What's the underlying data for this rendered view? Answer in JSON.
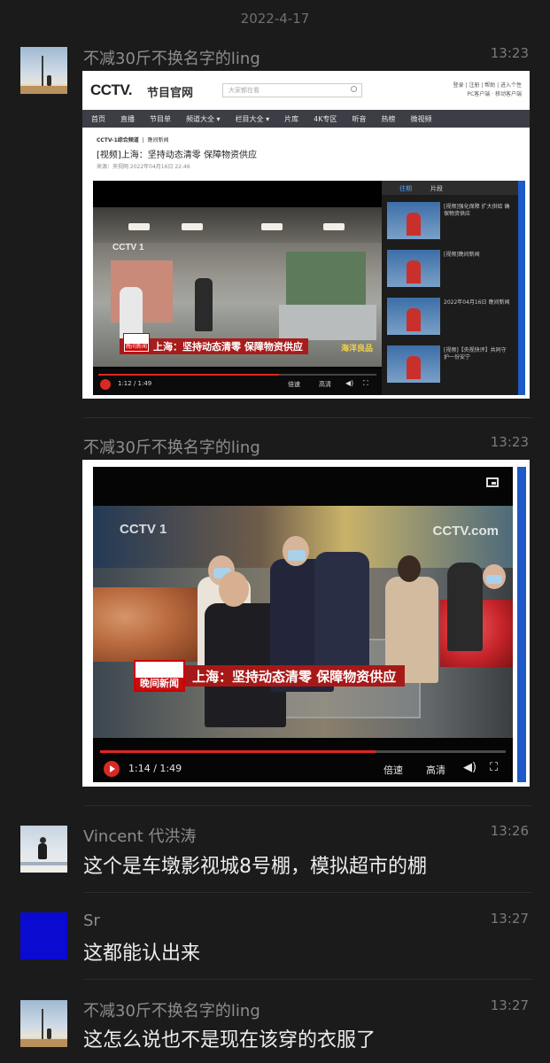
{
  "chat": {
    "date_separator": "2022-4-17",
    "messages": [
      {
        "sender": "不减30斤不换名字的ling",
        "time": "13:23",
        "type": "image"
      },
      {
        "sender": "不减30斤不换名字的ling",
        "time": "13:23",
        "type": "image"
      },
      {
        "sender": "Vincent 代洪涛",
        "time": "13:26",
        "text": "这个是车墩影视城8号棚，模拟超市的棚"
      },
      {
        "sender": "Sr",
        "time": "13:27",
        "text": "这都能认出来"
      },
      {
        "sender": "不减30斤不换名字的ling",
        "time": "13:27",
        "text": "这怎么说也不是现在该穿的衣服了"
      }
    ]
  },
  "screenshot1": {
    "logo": "CCTV.",
    "site_name": "节目官网",
    "search_placeholder": "大家都在看",
    "top_links": [
      "登录 | 注册 | 帮助 | 进入个性",
      "PC客户端 · 移动客户端"
    ],
    "nav": [
      "首页",
      "直播",
      "节目单",
      "频道大全 ▾",
      "栏目大全 ▾",
      "片库",
      "4K专区",
      "听音",
      "热榜",
      "微视频"
    ],
    "breadcrumb_channel": "CCTV-1综合频道",
    "breadcrumb_program": "晚间新闻",
    "title": "[视频]上海：坚持动态清零 保障物资供应",
    "meta": "来源：央视网  2022年04月16日 22:46",
    "video_watermark": "CCTV 1",
    "news_tag": "晚间新闻",
    "caption": "上海：坚持动态清零 保障物资供应",
    "corner_label": "海洋良品",
    "timecode": "1:12 / 1:49",
    "speed_label": "倍速",
    "quality_label": "高清",
    "progress": 0.65,
    "sidebar_tabs": [
      "往期",
      "片段"
    ],
    "sidebar_items": [
      "[视频]强化保障 扩大供给 确保物资供应",
      "[视频]晚间新闻",
      "2022年04月16日 晚间新闻",
      "[视频]【央视快评】共同守护一份安宁"
    ]
  },
  "screenshot2": {
    "watermark_left": "CCTV 1",
    "watermark_right": "CCTV.com",
    "news_tag": "晚间新闻",
    "caption": "上海：坚持动态清零 保障物资供应",
    "timecode": "1:14 / 1:49",
    "speed_label": "倍速",
    "quality_label": "高清",
    "progress": 0.68
  }
}
